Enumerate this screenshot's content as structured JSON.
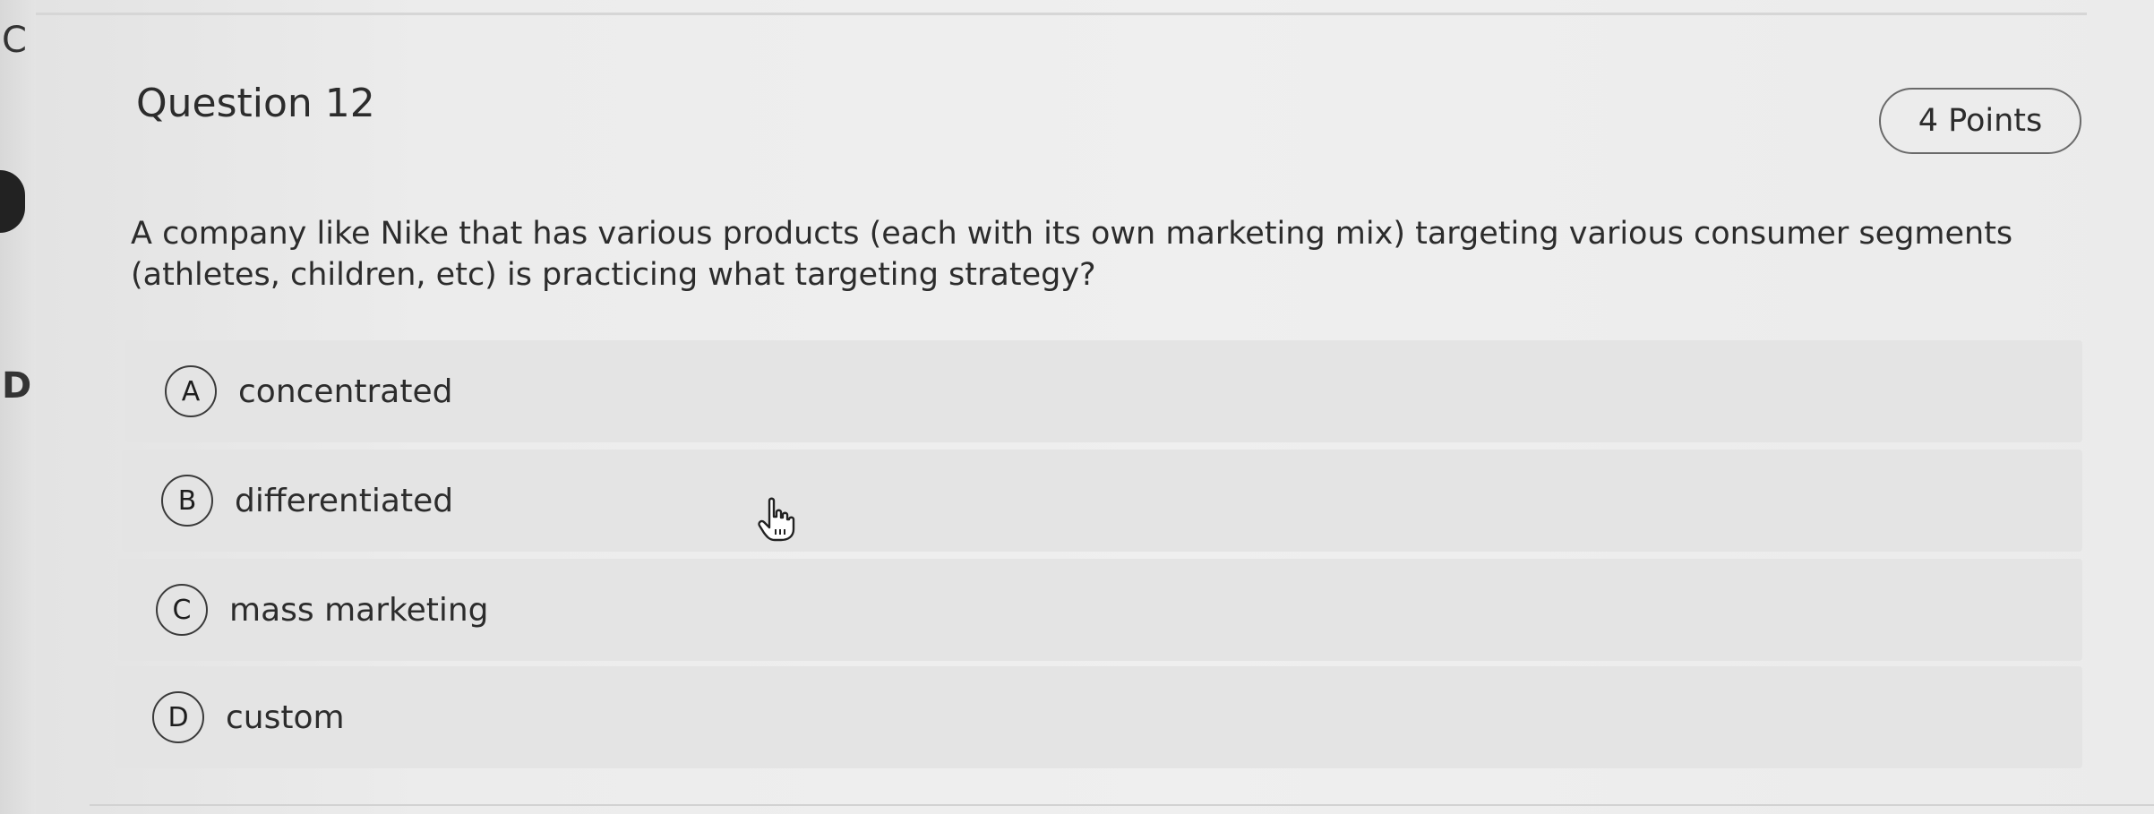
{
  "question": {
    "title": "Question 12",
    "points": "4 Points",
    "prompt": "A company like Nike that has various products (each with its own marketing mix) targeting various consumer segments (athletes, children, etc) is practicing what targeting strategy?"
  },
  "options": [
    {
      "letter": "A",
      "text": "concentrated"
    },
    {
      "letter": "B",
      "text": "differentiated"
    },
    {
      "letter": "C",
      "text": "mass marketing"
    },
    {
      "letter": "D",
      "text": "custom"
    }
  ],
  "gutter": {
    "top_letter": "C",
    "mid_letter": "D"
  },
  "icons": {
    "cursor": "hand-pointer-icon"
  }
}
